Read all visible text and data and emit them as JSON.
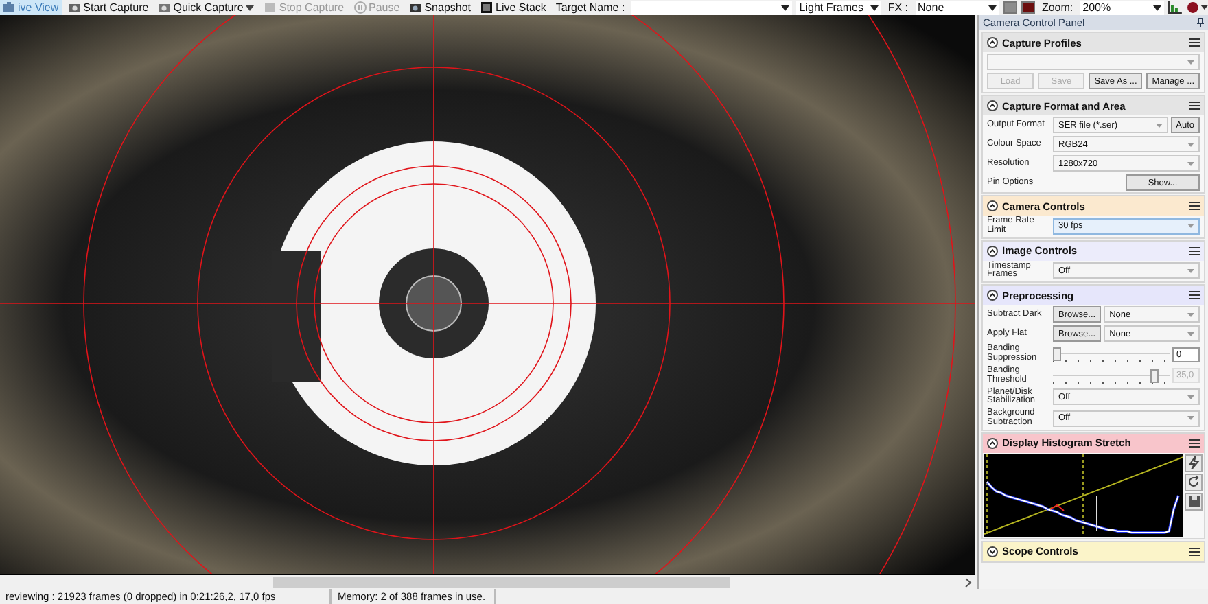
{
  "toolbar": [
    {
      "kind": "button",
      "label": "ive View",
      "selected": true,
      "disabled": false
    },
    {
      "kind": "button",
      "label": "Start Capture",
      "selected": false,
      "disabled": false
    },
    {
      "kind": "dropbutton",
      "label": "Quick Capture",
      "selected": false,
      "disabled": false
    },
    {
      "kind": "button",
      "label": "Stop Capture",
      "selected": false,
      "disabled": true
    },
    {
      "kind": "button",
      "label": "Pause",
      "selected": false,
      "disabled": true
    },
    {
      "kind": "button",
      "label": "Snapshot",
      "selected": false,
      "disabled": false
    },
    {
      "kind": "button",
      "label": "Live Stack",
      "selected": false,
      "disabled": false
    },
    {
      "kind": "label",
      "label": "Target Name :"
    },
    {
      "kind": "combo",
      "wide": true
    },
    {
      "kind": "combo",
      "value": "Light Frames"
    },
    {
      "kind": "label",
      "label": "FX :"
    },
    {
      "kind": "combo",
      "value": "None"
    },
    {
      "kind": "swatch",
      "color": "#8c8c8c"
    },
    {
      "kind": "swatch",
      "color": "#6b0d0d"
    },
    {
      "kind": "label",
      "label": "Zoom:"
    },
    {
      "kind": "combo",
      "value": "200%"
    },
    {
      "kind": "histogram"
    },
    {
      "kind": "colormenu"
    }
  ],
  "panel": {
    "title": "Camera Control Panel",
    "sections": [
      {
        "title": "Capture Profiles",
        "expanded": true,
        "color": "#e4e4e4",
        "rows": [
          {
            "kind": "combo"
          },
          {
            "kind": "buttons",
            "buttons": [
              {
                "label": "Load",
                "disabled": true
              },
              {
                "label": "Save",
                "disabled": true
              },
              {
                "label": "Save As ...",
                "disabled": false
              },
              {
                "label": "Manage ...",
                "disabled": false
              }
            ]
          }
        ]
      },
      {
        "title": "Capture Format and Area",
        "expanded": true,
        "color": "#e4e4e4",
        "rows": [
          {
            "kind": "combo",
            "label": "Output Format",
            "value": "SER file (*.ser)",
            "button": "Auto"
          },
          {
            "kind": "combo",
            "label": "Colour Space",
            "value": "RGB24"
          },
          {
            "kind": "combo",
            "label": "Resolution",
            "value": "1280x720"
          },
          {
            "kind": "action",
            "label": "Pin Options",
            "button": "Show..."
          }
        ]
      },
      {
        "title": "Camera Controls",
        "expanded": true,
        "color": "#fbe9cf",
        "rows": [
          {
            "kind": "combo",
            "label": "Frame Rate Limit",
            "value": "30 fps",
            "highlighted": true
          }
        ]
      },
      {
        "title": "Image Controls",
        "expanded": true,
        "color": "#ececfb",
        "rows": [
          {
            "kind": "combo",
            "label": "Timestamp Frames",
            "value": "Off"
          }
        ]
      },
      {
        "title": "Preprocessing",
        "expanded": true,
        "color": "#e6e6fb",
        "rows": [
          {
            "kind": "browse",
            "label": "Subtract Dark",
            "button": "Browse...",
            "value": "None"
          },
          {
            "kind": "browse",
            "label": "Apply Flat",
            "button": "Browse...",
            "value": "None"
          },
          {
            "kind": "slider",
            "label": "Banding Suppression",
            "level": 0,
            "value": "0",
            "disabled": false
          },
          {
            "kind": "slider",
            "label": "Banding Threshold",
            "level": 0.88,
            "value": "35,0",
            "disabled": true
          },
          {
            "kind": "combo",
            "label": "Planet/Disk Stabilization",
            "value": "Off"
          },
          {
            "kind": "combo",
            "label": "Background Subtraction",
            "value": "Off"
          }
        ]
      },
      {
        "title": "Display Histogram Stretch",
        "expanded": true,
        "color": "#f8c5cb",
        "rows": [
          {
            "kind": "histogram"
          }
        ]
      },
      {
        "title": "Scope Controls",
        "expanded": false,
        "color": "#fbf4c9"
      }
    ]
  },
  "status_bar": [
    "reviewing : 21923 frames (0 dropped) in 0:21:26,2, 17,0 fps",
    "Memory: 2 of 388 frames in use."
  ]
}
